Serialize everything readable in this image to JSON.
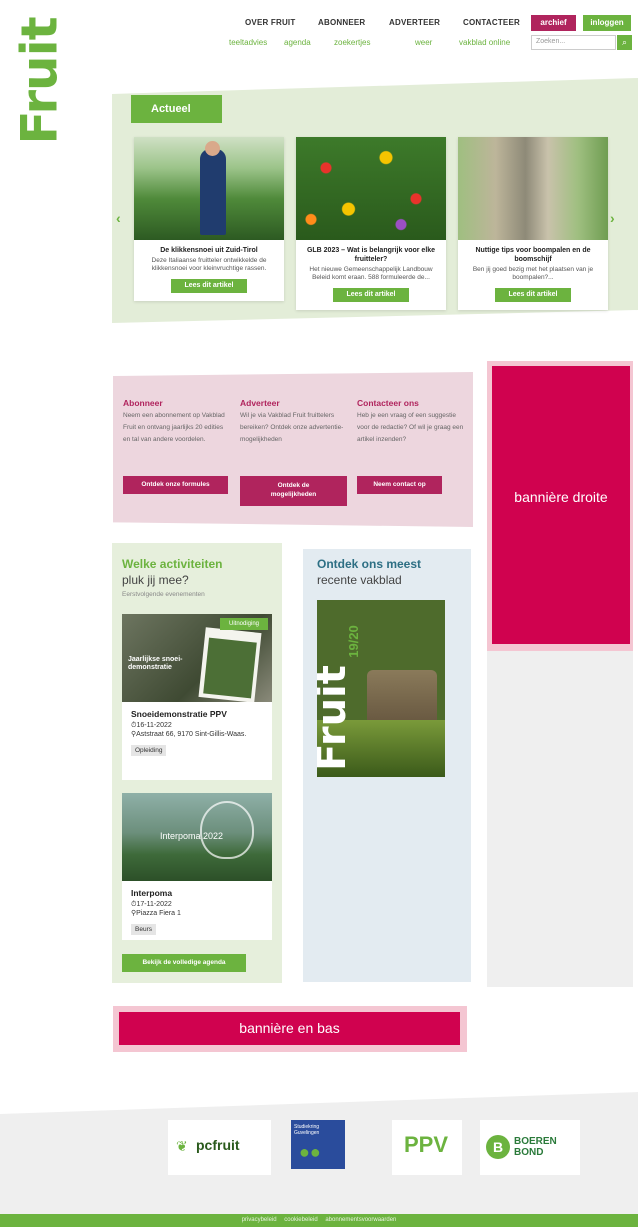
{
  "logo": {
    "text": "Fruit"
  },
  "nav": {
    "primary": [
      "OVER FRUIT",
      "ABONNEER",
      "ADVERTEER",
      "CONTACTEER"
    ],
    "archief": "archief",
    "inloggen": "inloggen",
    "secondary": [
      "teeltadvies",
      "agenda",
      "zoekertjes",
      "weer",
      "vakblad online"
    ],
    "search_placeholder": "Zoeken...",
    "search_icon": "search-icon"
  },
  "actueel": {
    "title": "Actueel",
    "cards": [
      {
        "title": "De klikkensnoei uit Zuid-Tirol",
        "text": "Deze Italiaanse fruitteler ontwikkelde de klikkensnoei voor kleinvruchtige rassen.",
        "button": "Lees dit artikel"
      },
      {
        "title": "GLB 2023 – Wat is belangrijk voor elke fruitteler?",
        "text": "Het nieuwe Gemeenschappelijk Landbouw Beleid komt eraan. 588 formuleerde de...",
        "button": "Lees dit artikel"
      },
      {
        "title": "Nuttige tips voor boompalen en de boomschijf",
        "text": "Ben jij goed bezig met het plaatsen van je boompalen?...",
        "button": "Lees dit artikel"
      }
    ]
  },
  "cta": {
    "abonneer": {
      "title": "Abonneer",
      "text": "Neem een abonnement op Vakblad Fruit en ontvang jaarlijks 20 edities en tal van andere voordelen.",
      "button": "Ontdek onze formules"
    },
    "adverteer": {
      "title": "Adverteer",
      "text": "Wil je via Vakblad Fruit fruittelers bereiken? Ontdek onze advertentie-mogelijkheden",
      "button": "Ontdek de mogelijkheden"
    },
    "contacteer": {
      "title": "Contacteer ons",
      "text": "Heb je een vraag of een suggestie voor de redactie? Of wil je graag een artikel inzenden?",
      "button": "Neem contact op"
    }
  },
  "banner_right": "bannière droite",
  "activities": {
    "title1": "Welke activiteiten",
    "title2": "pluk jij mee?",
    "subtitle": "Eerstvolgende evenementen",
    "events": [
      {
        "title": "Snoeidemonstratie PPV",
        "date": "16-11-2022",
        "place": "Aststraat 66, 9170 Sint-Gillis-Waas.",
        "tag": "Opleiding",
        "img_badge": "Uitnodiging",
        "img_caption": "Jaarlijkse snoei-demonstratie"
      },
      {
        "title": "Interpoma",
        "date": "17-11-2022",
        "place": "Piazza Fiera 1",
        "tag": "Beurs",
        "img_caption": "Interpoma 2022"
      }
    ],
    "agenda_button": "Bekijk de volledige agenda"
  },
  "vakblad": {
    "title1": "Ontdek ons meest",
    "title2": "recente vakblad",
    "cover_title": "Fruit",
    "cover_issue": "19/20"
  },
  "banner_bottom": "bannière en bas",
  "partners": [
    "pcfruit",
    "Studiekring Guvelingen",
    "PPV",
    "BOEREN BOND"
  ],
  "footer_links": [
    "privacybeleid",
    "cookiebeleid",
    "abonnementsvoorwaarden"
  ]
}
